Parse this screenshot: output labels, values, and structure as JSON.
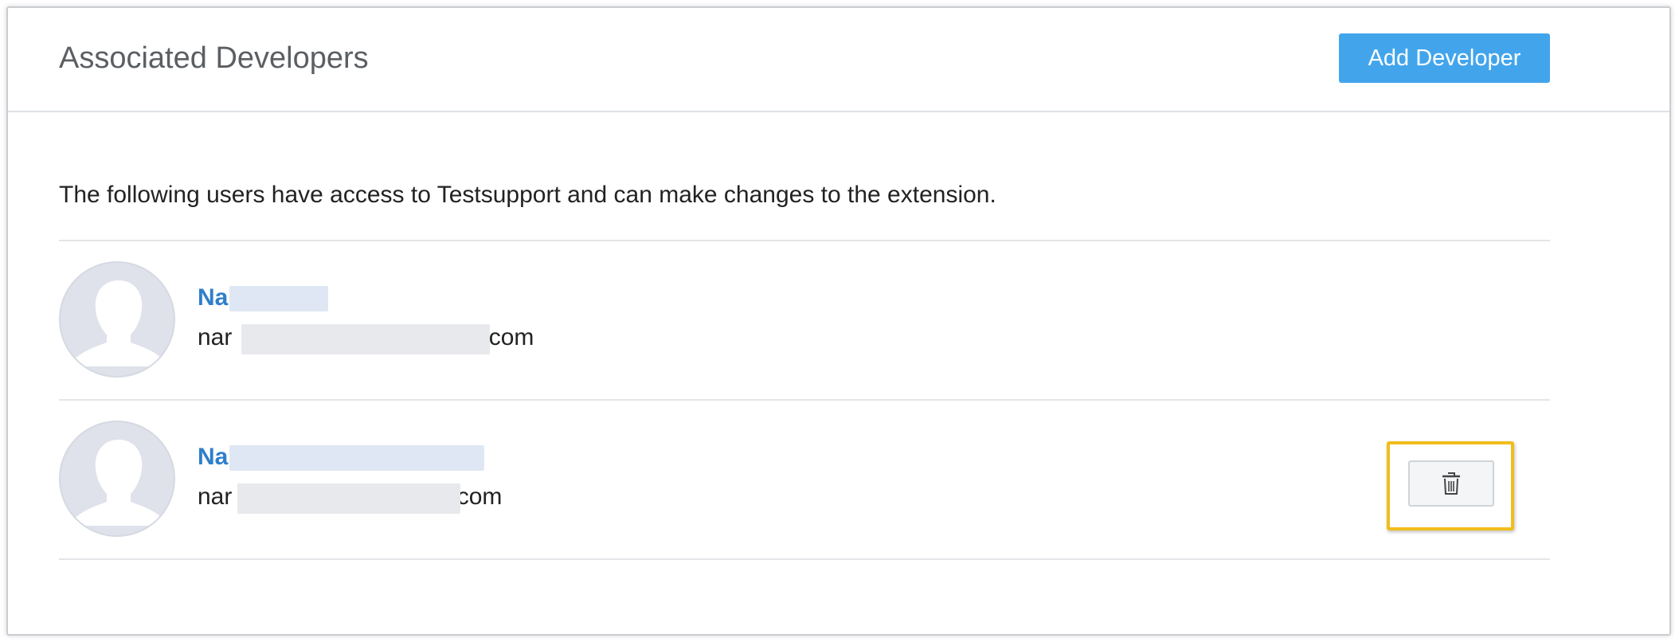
{
  "header": {
    "title": "Associated Developers",
    "add_button_label": "Add Developer"
  },
  "intro_text": "The following users have access to Testsupport and can make changes to the extension.",
  "developers": [
    {
      "name_visible": "Na",
      "email_prefix": "nar",
      "email_suffix": ".com"
    },
    {
      "name_visible": "Na",
      "email_prefix": "nar",
      "email_suffix": ".com"
    }
  ],
  "icons": {
    "avatar": "user-silhouette-icon",
    "delete": "trash-icon"
  },
  "colors": {
    "primary_button": "#42a5ec",
    "link": "#2f7fca",
    "highlight_border": "#f1bd1c"
  }
}
